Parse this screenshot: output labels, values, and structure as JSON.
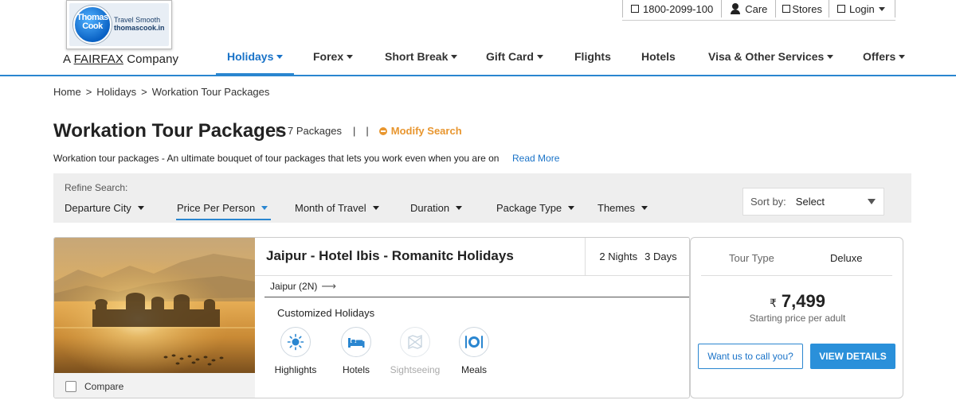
{
  "logo": {
    "brand": "Thomas Cook",
    "tagline_1": "Travel Smooth",
    "tagline_2": "thomascook.in",
    "company_prefix": "A",
    "company_name": "FAIRFAX",
    "company_suffix": "Company"
  },
  "topbar": {
    "phone": "1800-2099-100",
    "care": "Care",
    "stores": "Stores",
    "login": "Login"
  },
  "nav": {
    "items": [
      {
        "label": "Holidays",
        "has_caret": true,
        "active": true
      },
      {
        "label": "Forex",
        "has_caret": true
      },
      {
        "label": "Short Break",
        "has_caret": true
      },
      {
        "label": "Gift Card",
        "has_caret": true
      },
      {
        "label": "Flights",
        "has_caret": false
      },
      {
        "label": "Hotels",
        "has_caret": false
      },
      {
        "label": "Visa & Other Services",
        "has_caret": true
      },
      {
        "label": "Offers",
        "has_caret": true
      }
    ]
  },
  "breadcrumb": {
    "home": "Home",
    "holidays": "Holidays",
    "current": "Workation Tour Packages",
    "separator": ">"
  },
  "header": {
    "title": "Workation Tour Packages",
    "package_count": "7 Packages",
    "modify_search": "Modify Search",
    "description": "Workation tour packages - An ultimate bouquet of tour packages that lets you work even when you are on",
    "read_more": "Read More"
  },
  "filters": {
    "refine_label": "Refine Search:",
    "items": [
      "Departure City",
      "Price Per Person",
      "Month of Travel",
      "Duration",
      "Package Type",
      "Themes"
    ],
    "active_index": 1,
    "sort_label": "Sort by:",
    "sort_value": "Select"
  },
  "package": {
    "title": "Jaipur - Hotel Ibis - Romanitc Holidays",
    "nights": "2 Nights",
    "days": "3 Days",
    "route": "Jaipur (2N)",
    "category": "Customized Holidays",
    "compare_label": "Compare",
    "features": [
      {
        "label": "Highlights",
        "icon": "sun-icon",
        "enabled": true
      },
      {
        "label": "Hotels",
        "icon": "bed-icon",
        "enabled": true
      },
      {
        "label": "Sightseeing",
        "icon": "map-icon",
        "enabled": false
      },
      {
        "label": "Meals",
        "icon": "plate-cutlery-icon",
        "enabled": true
      }
    ],
    "tour_type_label": "Tour Type",
    "tour_type_value": "Deluxe",
    "currency_symbol": "₹",
    "price": "7,499",
    "price_note": "Starting price per adult",
    "call_button": "Want us to call you?",
    "view_button": "VIEW DETAILS"
  },
  "colors": {
    "primary_blue": "#2a86d0",
    "link_blue": "#1a73c8",
    "accent_orange": "#e8962f",
    "filter_bg": "#eeeeee"
  }
}
